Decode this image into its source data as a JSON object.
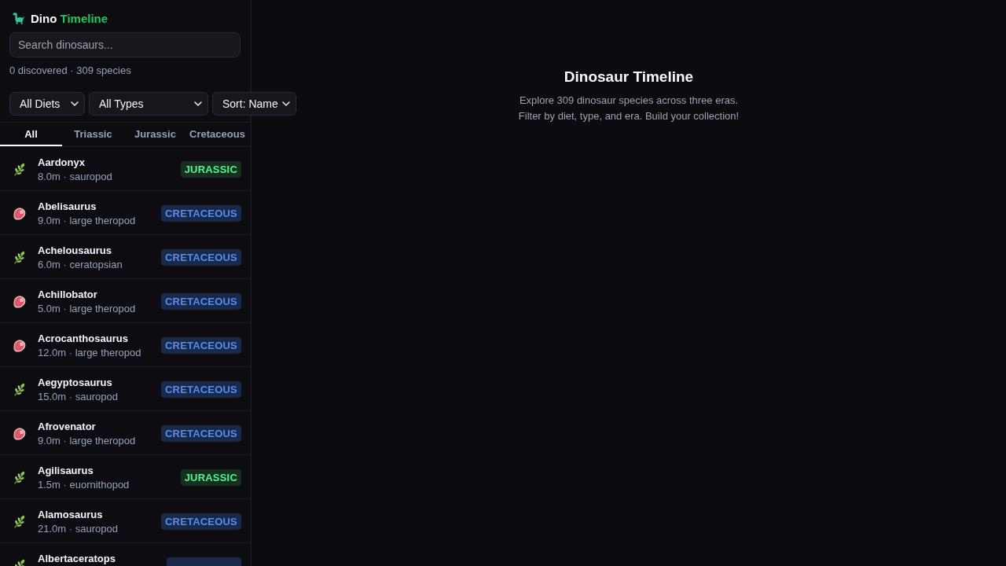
{
  "sidebar": {
    "logo": {
      "text": "Dino",
      "accent": "Timeline"
    },
    "search": {
      "placeholder": "Search dinosaurs..."
    },
    "stats": "0 discovered · 309 species",
    "filters": [
      "All Diets",
      "All Types",
      "Sort: Name"
    ],
    "tabs": [
      {
        "label": "All",
        "selected": true
      },
      {
        "label": "Triassic",
        "selected": false
      },
      {
        "label": "Jurassic",
        "selected": false
      },
      {
        "label": "Cretaceous",
        "selected": false
      }
    ],
    "species": [
      {
        "name": "Aardonyx",
        "details": "8.0m · sauropod",
        "kind": "herbivore",
        "era": {
          "label": "JURASSIC",
          "color": "#15301f"
        }
      },
      {
        "name": "Abelisaurus",
        "details": "9.0m · large theropod",
        "kind": "carnivore",
        "era": {
          "label": "CRETACEOUS",
          "color": "#172a4a"
        }
      },
      {
        "name": "Achelousaurus",
        "details": "6.0m · ceratopsian",
        "kind": "herbivore",
        "era": {
          "label": "CRETACEOUS",
          "color": "#172a4a"
        }
      },
      {
        "name": "Achillobator",
        "details": "5.0m · large theropod",
        "kind": "carnivore",
        "era": {
          "label": "CRETACEOUS",
          "color": "#172a4a"
        }
      },
      {
        "name": "Acrocanthosaurus",
        "details": "12.0m · large theropod",
        "kind": "carnivore",
        "era": {
          "label": "CRETACEOUS",
          "color": "#172a4a"
        }
      },
      {
        "name": "Aegyptosaurus",
        "details": "15.0m · sauropod",
        "kind": "herbivore",
        "era": {
          "label": "CRETACEOUS",
          "color": "#172a4a"
        }
      },
      {
        "name": "Afrovenator",
        "details": "9.0m · large theropod",
        "kind": "carnivore",
        "era": {
          "label": "CRETACEOUS",
          "color": "#172a4a"
        }
      },
      {
        "name": "Agilisaurus",
        "details": "1.5m · euornithopod",
        "kind": "herbivore",
        "era": {
          "label": "JURASSIC",
          "color": "#15301f"
        }
      },
      {
        "name": "Alamosaurus",
        "details": "21.0m · sauropod",
        "kind": "herbivore",
        "era": {
          "label": "CRETACEOUS",
          "color": "#172a4a"
        }
      },
      {
        "name": "Albertaceratops",
        "kind": "herbivore",
        "era": {
          "color": "#172a4a"
        }
      }
    ]
  },
  "main": {
    "title": "Dinosaur Timeline",
    "description": [
      "Explore 309 dinosaur species across three eras.",
      "Filter by diet, type, and era. Build your collection!"
    ]
  }
}
